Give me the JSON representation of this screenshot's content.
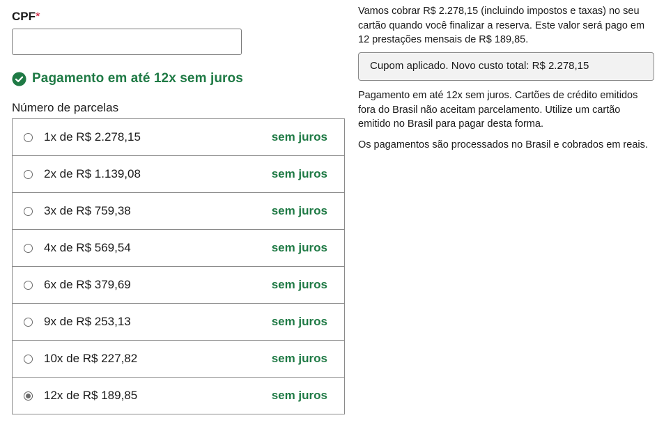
{
  "cpf": {
    "label": "CPF",
    "required_mark": "*",
    "value": "",
    "placeholder": ""
  },
  "promo": {
    "icon": "check-circle-icon",
    "text": "Pagamento em até 12x sem juros",
    "color": "#1f7a45"
  },
  "installments": {
    "label": "Número de parcelas",
    "selected_index": 7,
    "options": [
      {
        "label": "1x de R$ 2.278,15",
        "tag": "sem juros",
        "checked": false
      },
      {
        "label": "2x de R$ 1.139,08",
        "tag": "sem juros",
        "checked": false
      },
      {
        "label": "3x de R$ 759,38",
        "tag": "sem juros",
        "checked": false
      },
      {
        "label": "4x de R$ 569,54",
        "tag": "sem juros",
        "checked": false
      },
      {
        "label": "6x de R$ 379,69",
        "tag": "sem juros",
        "checked": false
      },
      {
        "label": "9x de R$ 253,13",
        "tag": "sem juros",
        "checked": false
      },
      {
        "label": "10x de R$ 227,82",
        "tag": "sem juros",
        "checked": false
      },
      {
        "label": "12x de R$ 189,85",
        "tag": "sem juros",
        "checked": true
      }
    ]
  },
  "summary": {
    "charge_text": "Vamos cobrar R$ 2.278,15 (incluindo impostos e taxas) no seu cartão quando você finalizar a reserva. Este valor será pago em 12 prestações mensais de R$ 189,85.",
    "coupon_text": "Cupom aplicado. Novo custo total: R$ 2.278,15",
    "info_installments": "Pagamento em até 12x sem juros. Cartões de crédito emitidos fora do Brasil não aceitam parcelamento. Utilize um cartão emitido no Brasil para pagar desta forma.",
    "info_processing": "Os pagamentos são processados no Brasil e cobrados em reais."
  }
}
